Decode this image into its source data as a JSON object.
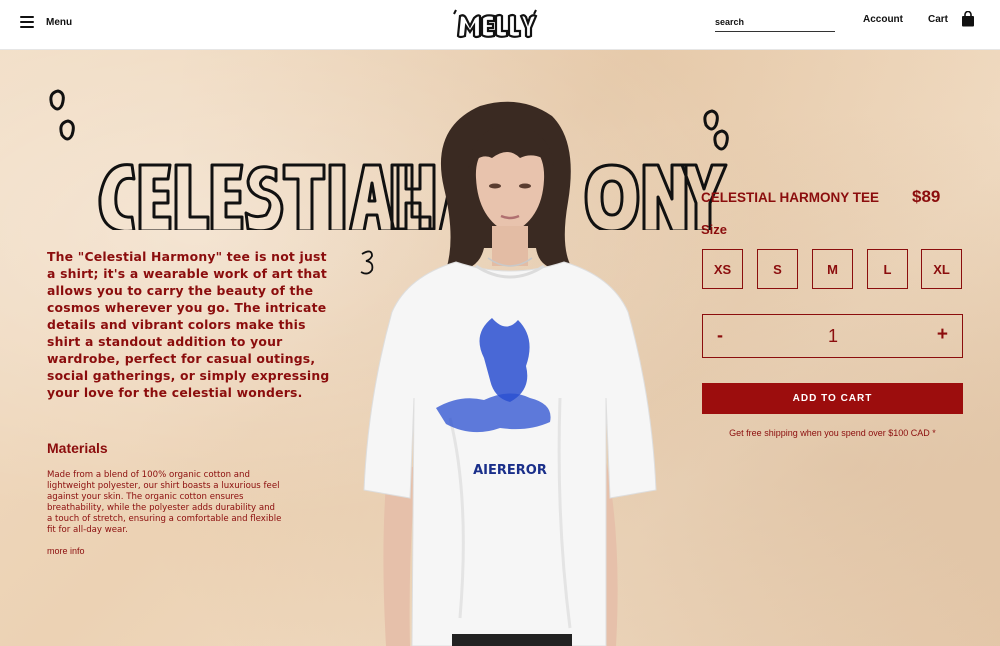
{
  "header": {
    "menu_label": "Menu",
    "logo_text": "MELLY",
    "search_placeholder": "search",
    "account_label": "Account",
    "cart_label": "Cart"
  },
  "hero": {
    "headline": "\"CELESTIAL HARMONY\"",
    "scribble_text": "3",
    "description": "The \"Celestial Harmony\" tee is not just a shirt; it's a wearable work of art that allows you to carry the beauty of the cosmos wherever you go. The intricate details and vibrant colors make this shirt a standout addition to your wardrobe, perfect for casual outings, social gatherings, or simply expressing your love for the celestial wonders.",
    "shirt_print_text": "AIEREROR"
  },
  "materials": {
    "title": "Materials",
    "text": "Made from a blend of 100% organic cotton and lightweight polyester, our shirt boasts a luxurious feel against your skin. The organic cotton ensures breathability, while the polyester adds durability and a touch of stretch, ensuring a comfortable and flexible fit for all-day wear.",
    "more_info": "more info"
  },
  "product": {
    "name": "CELESTIAL HARMONY TEE",
    "price": "$89",
    "size_label": "Size",
    "sizes": [
      "XS",
      "S",
      "M",
      "L",
      "XL"
    ],
    "quantity": "1",
    "minus": "-",
    "plus": "+",
    "add_to_cart": "ADD TO CART",
    "shipping_note": "Get free shipping when you spend over $100 CAD *"
  },
  "colors": {
    "accent": "#8b0d0d",
    "button": "#9c0d0d",
    "paper": "#efd8bd",
    "print_blue": "#2a4fd0"
  }
}
